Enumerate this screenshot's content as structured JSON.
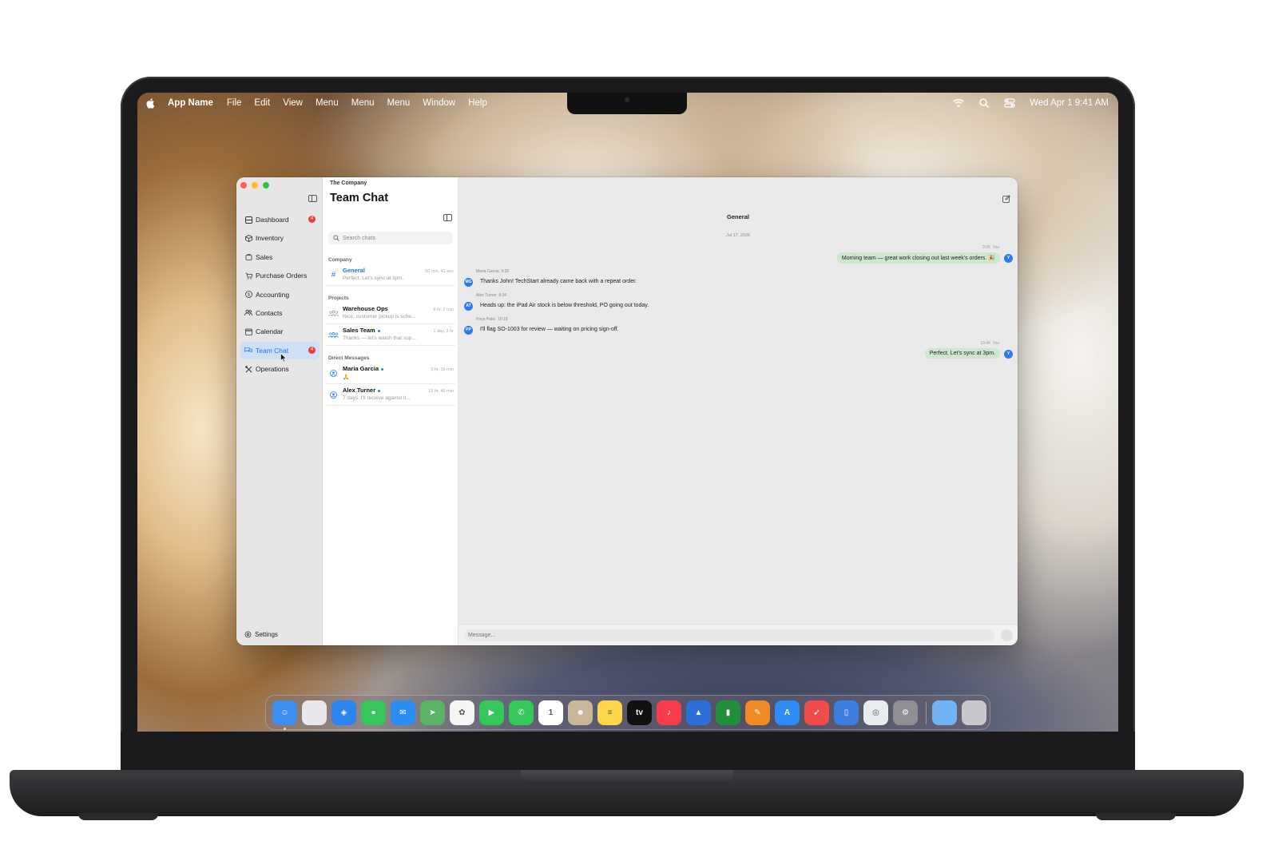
{
  "menubar": {
    "app_name": "App Name",
    "menus": [
      "File",
      "Edit",
      "View",
      "Menu",
      "Menu",
      "Menu",
      "Window",
      "Help"
    ],
    "clock": "Wed Apr 1  9:41 AM"
  },
  "sidebar": {
    "items": [
      {
        "label": "Dashboard",
        "icon": "dashboard-icon",
        "badge": "4"
      },
      {
        "label": "Inventory",
        "icon": "box-icon"
      },
      {
        "label": "Sales",
        "icon": "bag-icon"
      },
      {
        "label": "Purchase Orders",
        "icon": "cart-icon"
      },
      {
        "label": "Accounting",
        "icon": "dollar-icon"
      },
      {
        "label": "Contacts",
        "icon": "people-icon"
      },
      {
        "label": "Calendar",
        "icon": "calendar-icon"
      },
      {
        "label": "Team Chat",
        "icon": "chat-icon",
        "badge": "4",
        "active": true
      },
      {
        "label": "Operations",
        "icon": "tools-icon"
      }
    ],
    "settings_label": "Settings"
  },
  "chatlist": {
    "breadcrumb": "The Company",
    "title": "Team Chat",
    "search_placeholder": "Search chats",
    "sections": {
      "company": "Company",
      "projects": "Projects",
      "direct": "Direct Messages"
    },
    "chats": [
      {
        "name": "General",
        "preview": "Perfect. Let's sync at 3pm.",
        "time": "50 min, 41 sec",
        "icon": "hash-icon"
      },
      {
        "name": "Warehouse Ops",
        "preview": "Nice, customer pickup is sche...",
        "time": "8 hr, 2 min",
        "icon": "group-icon"
      },
      {
        "name": "Sales Team",
        "preview": "Thanks — let's watch that sup...",
        "time": "1 day, 3 hr",
        "icon": "group-icon"
      },
      {
        "name": "Maria Garcia",
        "preview": "🙏",
        "time": "3 hr, 16 min",
        "icon": "person-icon"
      },
      {
        "name": "Alex Turner",
        "preview": "7 days. I'll receive against it...",
        "time": "13 hr, 40 min",
        "icon": "person-icon"
      }
    ]
  },
  "conversation": {
    "title": "General",
    "date": "Jul 17, 2026",
    "messages": [
      {
        "sender": "You",
        "time": "9:05",
        "text": "Morning team — great work closing out last week's orders. 🎉",
        "avatar": "Y"
      },
      {
        "sender": "Maria Garcia",
        "time": "9:20",
        "text": "Thanks John! TechStart already came back with a repeat order.",
        "avatar": "MG"
      },
      {
        "sender": "Alex Turner",
        "time": "9:34",
        "text": "Heads up: the iPad Air stock is below threshold, PO going out today.",
        "avatar": "AT"
      },
      {
        "sender": "Priya Patel",
        "time": "10:18",
        "text": "I'll flag SO-1003 for review — waiting on pricing sign-off.",
        "avatar": "PP"
      },
      {
        "sender": "You",
        "time": "10:44",
        "text": "Perfect. Let's sync at 3pm.",
        "avatar": "Y"
      }
    ],
    "input_placeholder": "Message..."
  },
  "dock": {
    "apps": [
      {
        "name": "finder-icon",
        "color": "#3d8ef0",
        "glyph": "☺"
      },
      {
        "name": "launchpad-icon",
        "color": "#e8e8ec",
        "glyph": ""
      },
      {
        "name": "safari-icon",
        "color": "#2b84f0",
        "glyph": "◈"
      },
      {
        "name": "messages-icon",
        "color": "#35c759",
        "glyph": "●"
      },
      {
        "name": "mail-icon",
        "color": "#2b8cf3",
        "glyph": "✉"
      },
      {
        "name": "maps-icon",
        "color": "#5bb36a",
        "glyph": "➤"
      },
      {
        "name": "photos-icon",
        "color": "#f5f5f5",
        "glyph": "✿"
      },
      {
        "name": "facetime-icon",
        "color": "#34c759",
        "glyph": "▶"
      },
      {
        "name": "phone-icon",
        "color": "#34c759",
        "glyph": "✆"
      },
      {
        "name": "calendar-icon",
        "color": "#ffffff",
        "glyph": "1"
      },
      {
        "name": "contacts-icon",
        "color": "#c9b79c",
        "glyph": "☻"
      },
      {
        "name": "notes-icon",
        "color": "#ffd54a",
        "glyph": "≡"
      },
      {
        "name": "tv-icon",
        "color": "#111111",
        "glyph": "tv"
      },
      {
        "name": "music-icon",
        "color": "#fa3b4e",
        "glyph": "♪"
      },
      {
        "name": "keynote-icon",
        "color": "#2d6fd9",
        "glyph": "▲"
      },
      {
        "name": "numbers-icon",
        "color": "#1f8f3a",
        "glyph": "▮"
      },
      {
        "name": "pages-icon",
        "color": "#f08a24",
        "glyph": "✎"
      },
      {
        "name": "app-store-icon",
        "color": "#2d8cf5",
        "glyph": "A"
      },
      {
        "name": "rocket-icon",
        "color": "#f04c4c",
        "glyph": "➹"
      },
      {
        "name": "simulator-icon",
        "color": "#3b7de0",
        "glyph": "▯"
      },
      {
        "name": "disk-utility-icon",
        "color": "#e9ecef",
        "glyph": "◎"
      },
      {
        "name": "system-settings-icon",
        "color": "#8e8e93",
        "glyph": "⚙"
      },
      {
        "name": "folder-icon",
        "color": "#6fb3f2",
        "glyph": ""
      },
      {
        "name": "trash-icon",
        "color": "#c8c8cc",
        "glyph": ""
      }
    ]
  }
}
